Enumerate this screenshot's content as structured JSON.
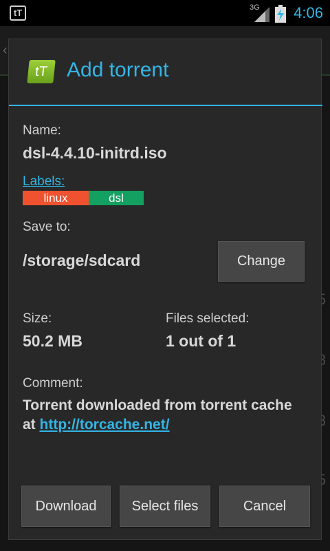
{
  "status_bar": {
    "app_icon_text": "tT",
    "network": "3G",
    "time": "4:06"
  },
  "background": {
    "digits": [
      "5",
      "8",
      "8",
      "5"
    ]
  },
  "dialog": {
    "logo_text": "tT",
    "title": "Add torrent",
    "name_label": "Name:",
    "name_value": "dsl-4.4.10-initrd.iso",
    "labels_link": "Labels:",
    "labels": [
      {
        "text": "linux",
        "color": "#f0522f"
      },
      {
        "text": "dsl",
        "color": "#13a060"
      }
    ],
    "save_label": "Save to:",
    "save_path": "/storage/sdcard",
    "change_button": "Change",
    "size_label": "Size:",
    "size_value": "50.2 MB",
    "files_label": "Files selected:",
    "files_value": "1 out of 1",
    "comment_label": "Comment:",
    "comment_text": "Torrent downloaded from torrent cache at ",
    "comment_link": "http://torcache.net/",
    "buttons": {
      "download": "Download",
      "select_files": "Select files",
      "cancel": "Cancel"
    }
  },
  "colors": {
    "accent": "#33b5e5",
    "label_linux": "#f0522f",
    "label_dsl": "#13a060"
  }
}
